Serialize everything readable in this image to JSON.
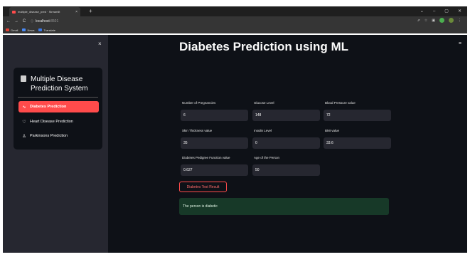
{
  "browser": {
    "tab_title": "multiple_disease_pred · Streamlit",
    "tab_close": "×",
    "new_tab": "+",
    "window_controls": [
      "⌄",
      "–",
      "▢",
      "✕"
    ],
    "nav": {
      "back": "←",
      "forward": "→",
      "reload": "C",
      "info": "ⓘ"
    },
    "url_host": "localhost",
    "url_port": ":8501",
    "toolbar_icons": [
      "⇗",
      "☆",
      "▣"
    ],
    "profile": "P",
    "menu": "⋮",
    "bookmarks": [
      "Gmail",
      "News",
      "Translate"
    ]
  },
  "sidebar": {
    "close": "×",
    "menu_title": "Multiple Disease Prediction System",
    "items": [
      {
        "label": "Diabetes Prediction",
        "icon": "activity-icon",
        "glyph": "∿",
        "active": true
      },
      {
        "label": "Heart Disease Prediction",
        "icon": "heart-icon",
        "glyph": "♡",
        "active": false
      },
      {
        "label": "Parkinsons Prediction",
        "icon": "person-icon",
        "glyph": "♙",
        "active": false
      }
    ]
  },
  "main": {
    "menu_glyph": "≡",
    "title": "Diabetes Prediction using ML",
    "fields": [
      {
        "label": "Number of Pregnancies",
        "value": "6"
      },
      {
        "label": "Glucose Level",
        "value": "148"
      },
      {
        "label": "Blood Pressure value",
        "value": "72"
      },
      {
        "label": "Skin Thickness value",
        "value": "35"
      },
      {
        "label": "Insulin Level",
        "value": "0"
      },
      {
        "label": "BMI value",
        "value": "33.6"
      },
      {
        "label": "Diabetes Pedigree Function value",
        "value": "0.627"
      },
      {
        "label": "Age of the Person",
        "value": "50"
      }
    ],
    "button_label": "Diabetes Test Result",
    "result_text": "The person is diabetic"
  },
  "colors": {
    "accent": "#ff4b4b",
    "app_bg": "#0e1117",
    "sidebar_bg": "#262730",
    "success_bg": "#173928"
  }
}
